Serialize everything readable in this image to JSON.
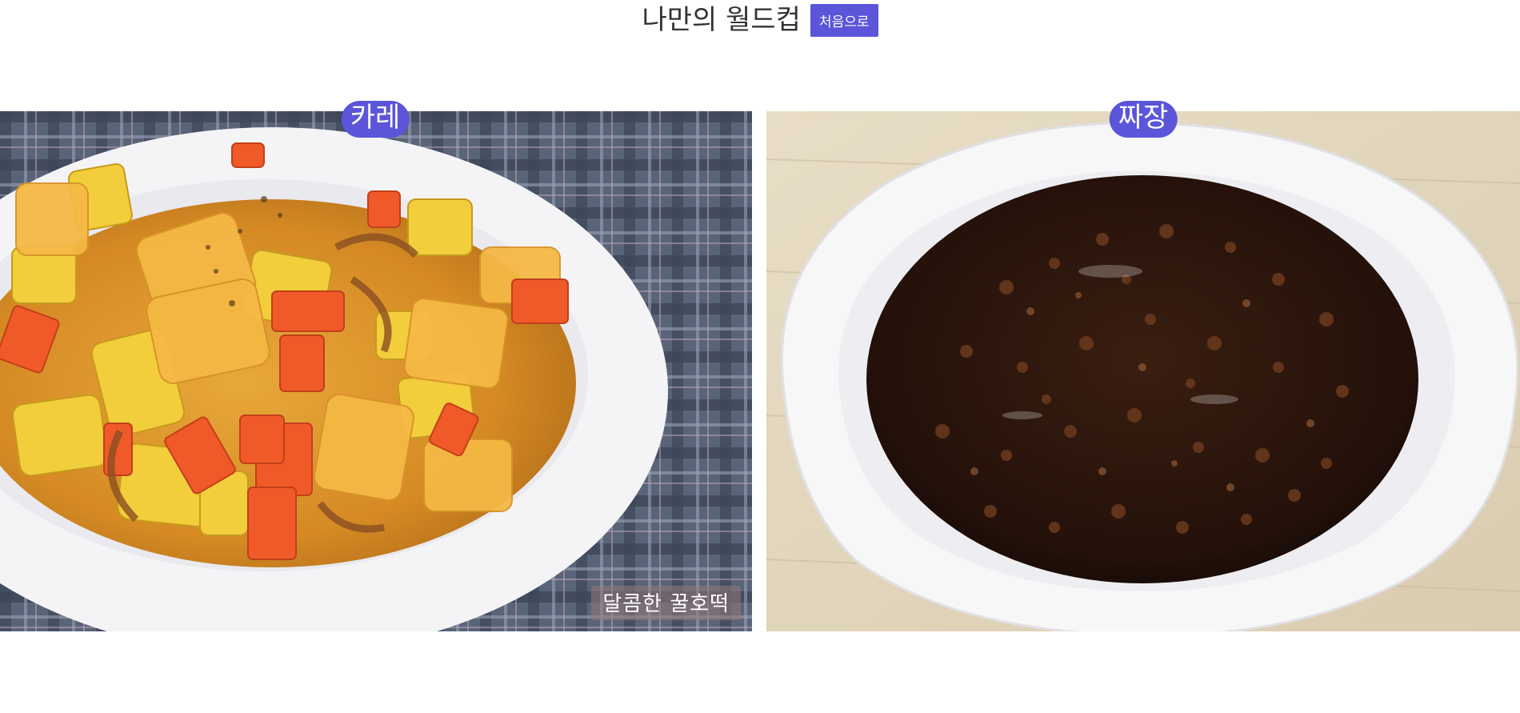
{
  "header": {
    "title": "나만의 월드컵",
    "reset_button": "처음으로"
  },
  "candidates": [
    {
      "name": "카레",
      "watermark": "달콤한 꿀호떡"
    },
    {
      "name": "짜장"
    }
  ],
  "colors": {
    "accent": "#5a55d9"
  }
}
